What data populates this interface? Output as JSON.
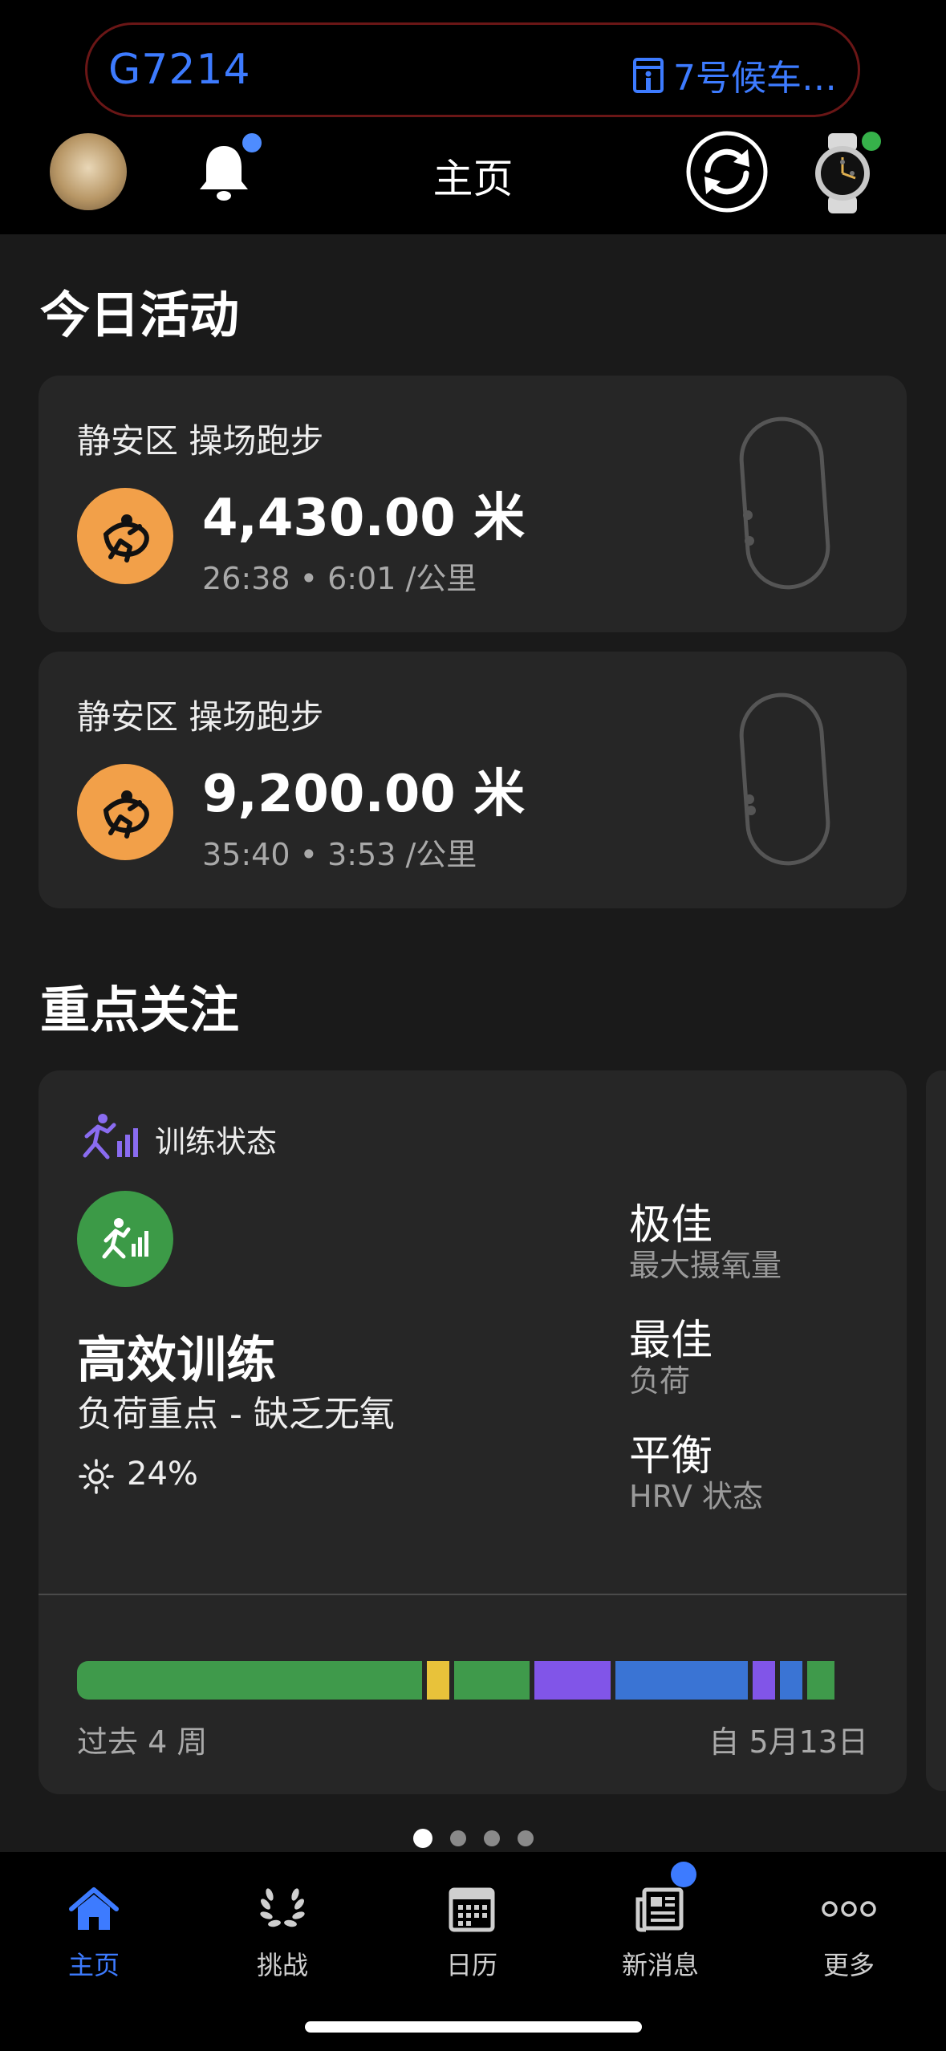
{
  "header": {
    "flight_number": "G7214",
    "gate_text": "7号候车…",
    "title": "主页"
  },
  "today": {
    "section_title": "今日活动",
    "activities": [
      {
        "name": "静安区 操场跑步",
        "distance": "4,430.00 米",
        "meta": "26:38 • 6:01 /公里",
        "icon": "running-activity-icon"
      },
      {
        "name": "静安区 操场跑步",
        "distance": "9,200.00 米",
        "meta": "35:40 • 3:53 /公里",
        "icon": "running-activity-icon"
      }
    ]
  },
  "focus": {
    "section_title": "重点关注",
    "card_title": "训练状态",
    "status": "高效训练",
    "subtitle": "负荷重点 - 缺乏无氧",
    "sun_percent": "24%",
    "metrics": [
      {
        "value": "极佳",
        "label": "最大摄氧量"
      },
      {
        "value": "最佳",
        "label": "负荷"
      },
      {
        "value": "平衡",
        "label": "HRV 状态"
      }
    ],
    "history_left": "过去 4 周",
    "history_right": "自 5月13日",
    "history_segments": [
      {
        "color": "#3f9a4b",
        "fraction": 0.455
      },
      {
        "color": "#e8c23a",
        "fraction": 0.03
      },
      {
        "color": "#3f9a4b",
        "fraction": 0.1
      },
      {
        "color": "#8155e8",
        "fraction": 0.1
      },
      {
        "color": "#3a74d4",
        "fraction": 0.175
      },
      {
        "color": "#8155e8",
        "fraction": 0.03
      },
      {
        "color": "#3a74d4",
        "fraction": 0.03
      },
      {
        "color": "#3f9a4b",
        "fraction": 0.035
      }
    ]
  },
  "pager": {
    "count": 4,
    "active": 0
  },
  "tabs": [
    {
      "label": "主页",
      "icon": "home-icon",
      "active": true
    },
    {
      "label": "挑战",
      "icon": "laurel-icon",
      "active": false
    },
    {
      "label": "日历",
      "icon": "calendar-icon",
      "active": false
    },
    {
      "label": "新消息",
      "icon": "news-icon",
      "active": false
    },
    {
      "label": "更多",
      "icon": "more-icon",
      "active": false
    }
  ],
  "colors": {
    "accent_blue": "#3d7bff",
    "activity_orange": "#f2a049",
    "status_green": "#3c9a47"
  }
}
